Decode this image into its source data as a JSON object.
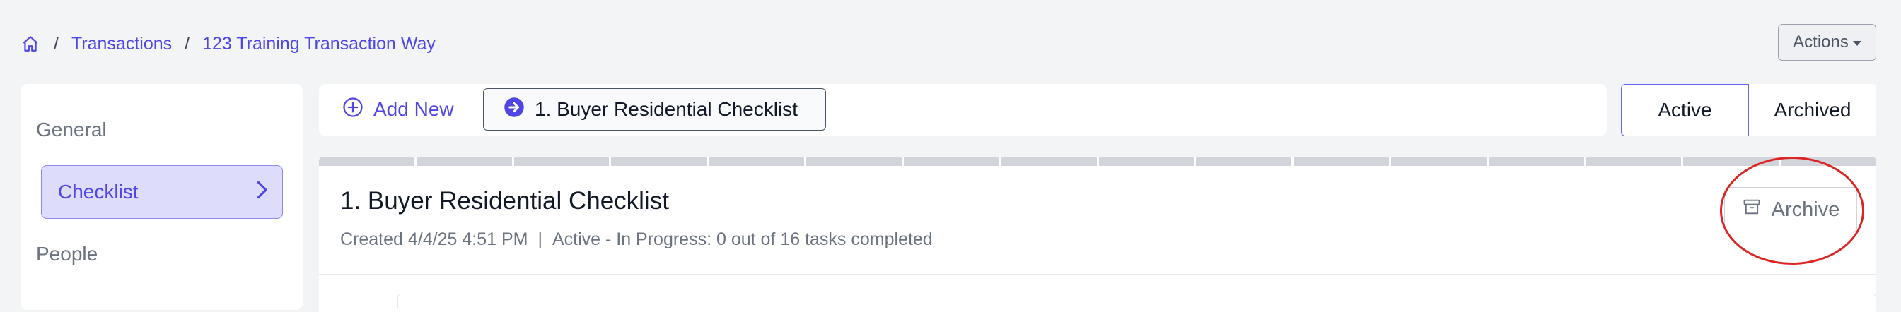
{
  "breadcrumb": {
    "home_icon": "home-icon",
    "separator": "/",
    "items": [
      "Transactions",
      "123 Training Transaction Way"
    ]
  },
  "header": {
    "actions_label": "Actions"
  },
  "sidebar": {
    "items": [
      {
        "label": "General"
      },
      {
        "label": "Checklist",
        "active": true
      },
      {
        "label": "People"
      }
    ]
  },
  "toolbar": {
    "add_new_label": "Add New",
    "checklist_pill_label": "1. Buyer Residential Checklist",
    "filter_tabs": [
      "Active",
      "Archived"
    ],
    "selected_filter": "Active"
  },
  "checklist": {
    "title": "1. Buyer Residential Checklist",
    "created": "Created 4/4/25 4:51 PM",
    "meta_separator": "|",
    "status": "Active - In Progress: 0 out of 16 tasks completed",
    "archive_label": "Archive",
    "progress_segments": 16,
    "completed_segments": 0
  },
  "colors": {
    "accent": "#4f46e5",
    "active_bg": "#dedcfb",
    "annotation": "#dc2626"
  }
}
